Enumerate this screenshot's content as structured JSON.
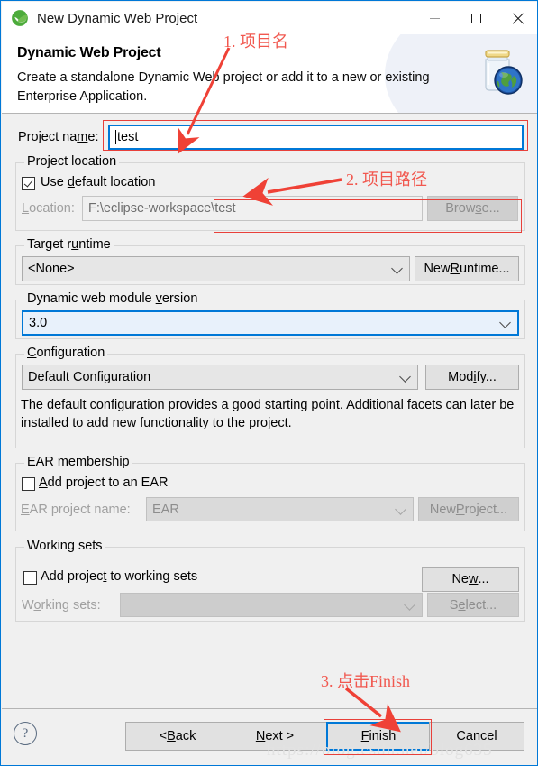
{
  "window": {
    "title": "New Dynamic Web Project",
    "icon": "eclipse-leaf-icon",
    "minimize_label": "—",
    "maximize_label": "□",
    "close_label": "✕"
  },
  "banner": {
    "title": "Dynamic Web Project",
    "description": "Create a standalone Dynamic Web project or add it to a new or existing Enterprise Application.",
    "art": "jar-globe-icon"
  },
  "project_name": {
    "label_prefix": "Project na",
    "label_mnemonic": "m",
    "label_suffix": "e:",
    "value": "test"
  },
  "project_location": {
    "group_title": "Project location",
    "use_default_prefix": "Use ",
    "use_default_mnemonic": "d",
    "use_default_suffix": "efault location",
    "use_default_checked": true,
    "location_label_mnemonic": "L",
    "location_label_suffix": "ocation:",
    "location_value": "F:\\eclipse-workspace\\test",
    "browse_prefix": "Brow",
    "browse_mnemonic": "s",
    "browse_suffix": "e..."
  },
  "target_runtime": {
    "group_title_prefix": "Target r",
    "group_title_mnemonic": "u",
    "group_title_suffix": "ntime",
    "value": "<None>",
    "new_runtime_prefix": "New ",
    "new_runtime_mnemonic": "R",
    "new_runtime_suffix": "untime..."
  },
  "web_module_version": {
    "group_title_prefix": "Dynamic web module ",
    "group_title_mnemonic": "v",
    "group_title_suffix": "ersion",
    "value": "3.0"
  },
  "configuration": {
    "group_title_mnemonic": "C",
    "group_title_suffix": "onfiguration",
    "value": "Default Configuration",
    "modify_prefix": "Mod",
    "modify_mnemonic": "i",
    "modify_suffix": "fy...",
    "description": "The default configuration provides a good starting point. Additional facets can later be installed to add new functionality to the project."
  },
  "ear_membership": {
    "group_title": "EAR membership",
    "add_prefix": "",
    "add_mnemonic": "A",
    "add_suffix": "dd project to an EAR",
    "add_checked": false,
    "ear_label_mnemonic": "E",
    "ear_label_suffix": "AR project name:",
    "ear_value": "EAR",
    "new_project_prefix": "New ",
    "new_project_mnemonic": "P",
    "new_project_suffix": "roject..."
  },
  "working_sets": {
    "group_title": "Working sets",
    "add_prefix": "Add projec",
    "add_mnemonic": "t",
    "add_suffix": " to working sets",
    "add_checked": false,
    "new_prefix": "Ne",
    "new_mnemonic": "w",
    "new_suffix": "...",
    "sets_label_prefix": "W",
    "sets_label_mnemonic": "o",
    "sets_label_suffix": "rking sets:",
    "sets_value": "",
    "select_prefix": "S",
    "select_mnemonic": "e",
    "select_suffix": "lect..."
  },
  "buttons": {
    "help_label": "?",
    "back_prefix": "< ",
    "back_mnemonic": "B",
    "back_suffix": "ack",
    "next_mnemonic": "N",
    "next_suffix": "ext >",
    "finish_prefix": "",
    "finish_mnemonic": "F",
    "finish_suffix": "inish",
    "cancel_label": "Cancel"
  },
  "annotations": [
    {
      "text": "1. 项目名",
      "target": "project-name-field"
    },
    {
      "text": "2. 项目路径",
      "target": "location-field"
    },
    {
      "text": "3. 点击Finish",
      "target": "finish-button"
    }
  ],
  "watermark": "https://blog.csdn.net/blog635",
  "colors": {
    "accent": "#0078d7",
    "annotation": "#e8403a",
    "dialog_bg": "#f0f0f0",
    "banner_bg": "#ffffff"
  }
}
